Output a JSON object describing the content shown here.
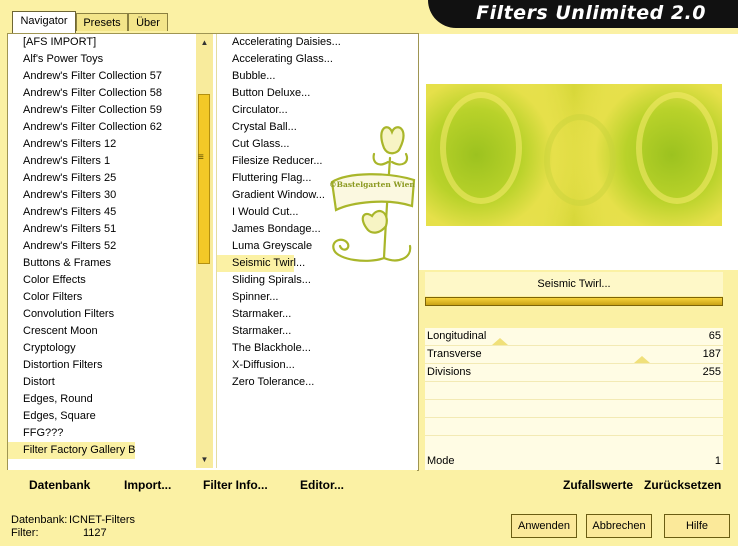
{
  "app": {
    "title": "Filters Unlimited 2.0"
  },
  "tabs": [
    {
      "label": "Navigator",
      "active": true
    },
    {
      "label": "Presets",
      "active": false
    },
    {
      "label": "Über",
      "active": false
    }
  ],
  "categories": [
    "[AFS IMPORT]",
    "Alf's Power Toys",
    "Andrew's Filter Collection 57",
    "Andrew's Filter Collection 58",
    "Andrew's Filter Collection 59",
    "Andrew's Filter Collection 62",
    "Andrew's Filters 12",
    "Andrew's Filters 1",
    "Andrew's Filters 25",
    "Andrew's Filters 30",
    "Andrew's Filters 45",
    "Andrew's Filters 51",
    "Andrew's Filters 52",
    "Buttons & Frames",
    "Color Effects",
    "Color Filters",
    "Convolution Filters",
    "Crescent Moon",
    "Cryptology",
    "Distortion Filters",
    "Distort",
    "Edges, Round",
    "Edges, Square",
    "FFG???",
    "Filter Factory Gallery B"
  ],
  "selected_category_index": 24,
  "filters": [
    "Accelerating Daisies...",
    "Accelerating Glass...",
    "Bubble...",
    "Button Deluxe...",
    "Circulator...",
    "Crystal Ball...",
    "Cut Glass...",
    "Filesize Reducer...",
    "Fluttering Flag...",
    "Gradient Window...",
    "I Would Cut...",
    "James Bondage...",
    "Luma Greyscale",
    "Seismic Twirl...",
    "Sliding Spirals...",
    "Spinner...",
    "Starmaker...",
    "Starmaker...",
    "The Blackhole...",
    "X-Diffusion...",
    "Zero Tolerance..."
  ],
  "selected_filter_index": 13,
  "watermark": {
    "text": "©Bastelgarten Wien"
  },
  "preview": {
    "filter_name": "Seismic Twirl..."
  },
  "params": [
    {
      "label": "Longitudinal",
      "value": "65",
      "fraction": 0.255
    },
    {
      "label": "Transverse",
      "value": "187",
      "fraction": 0.733
    },
    {
      "label": "Divisions",
      "value": "255",
      "fraction": 1.0
    }
  ],
  "mode": {
    "label": "Mode",
    "value": "1"
  },
  "left_buttons": {
    "database": "Datenbank",
    "import": "Import...",
    "filter_info": "Filter Info...",
    "editor": "Editor..."
  },
  "right_buttons": {
    "random": "Zufallswerte",
    "reset": "Zurücksetzen"
  },
  "status": {
    "db_label": "Datenbank:",
    "db_value": "ICNET-Filters",
    "filter_label": "Filter:",
    "filter_value": "1127"
  },
  "dialog_buttons": {
    "apply": "Anwenden",
    "cancel": "Abbrechen",
    "help": "Hilfe"
  },
  "colors": {
    "background": "#fbf1a4",
    "accent": "#f3c927",
    "title_band": "#111111"
  }
}
